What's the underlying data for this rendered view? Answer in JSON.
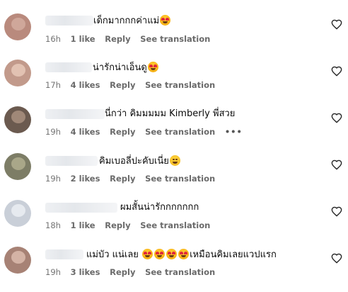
{
  "comments": [
    {
      "text_parts": [
        "เด็กมากกกค่าแม่",
        "emoji:star-struck"
      ],
      "time": "16h",
      "likes": "1 like",
      "reply": "Reply",
      "see_translation": "See translation",
      "show_more": false,
      "avatar_colors": [
        "#b98a7d",
        "#cfa79a"
      ]
    },
    {
      "text_parts": [
        "น่ารักน่าเอ็นดู",
        "emoji:star-struck"
      ],
      "time": "17h",
      "likes": "4 likes",
      "reply": "Reply",
      "see_translation": "See translation",
      "show_more": false,
      "avatar_colors": [
        "#c29a8b",
        "#e2c2b2"
      ]
    },
    {
      "text_parts": [
        "นี่กว่า คิมมมมม Kimberly พี่สวย"
      ],
      "time": "19h",
      "likes": "4 likes",
      "reply": "Reply",
      "see_translation": "See translation",
      "show_more": true,
      "show_more_icon": "more-dots-icon",
      "avatar_colors": [
        "#6b5a4f",
        "#a08878"
      ]
    },
    {
      "text_parts": [
        "คิมเบอลี่ปะคับเนี่ย",
        "emoji:smile"
      ],
      "time": "19h",
      "likes": "2 likes",
      "reply": "Reply",
      "see_translation": "See translation",
      "show_more": false,
      "avatar_colors": [
        "#7d7d66",
        "#a9a789"
      ]
    },
    {
      "text_parts": [
        "ผมสั้นน่ารักกกกกกก"
      ],
      "time": "18h",
      "likes": "1 like",
      "reply": "Reply",
      "see_translation": "See translation",
      "show_more": false,
      "avatar_colors": [
        "#c9cfd8",
        "#e6eaef"
      ]
    },
    {
      "text_parts": [
        "แม่บัว แน่เลย",
        "emoji:star-struck",
        "emoji:star-struck",
        "emoji:star-struck",
        "emoji:star-struck",
        "เหมือนคิมเลยแวปแรก"
      ],
      "time": "19h",
      "likes": "3 likes",
      "reply": "Reply",
      "see_translation": "See translation",
      "show_more": false,
      "avatar_colors": [
        "#a78275",
        "#d4b3a5"
      ]
    }
  ],
  "icons": {
    "like": "heart-outline-icon",
    "emoji_star": "star-struck-emoji-icon",
    "emoji_smile": "smiling-face-emoji-icon"
  },
  "colors": {
    "meta_text": "#737373",
    "body_text": "#0a0a0a"
  }
}
